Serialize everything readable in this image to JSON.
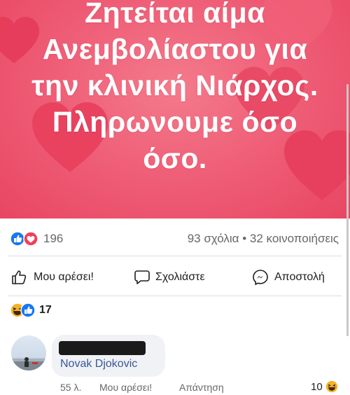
{
  "post": {
    "text_lines": [
      "Ζητείται αίμα",
      "Ανεμβολίαστου για",
      "την κλινική Νιάρχος.",
      "Πληρωνουμε όσο",
      "όσο."
    ],
    "background_color": "#ee5b74"
  },
  "reactions": {
    "count": "196",
    "icons": [
      "like-icon",
      "love-icon"
    ]
  },
  "stats": {
    "comments_shares": "93 σχόλια • 32 κοινοποιήσεις"
  },
  "actions": {
    "like": "Μου αρέσει!",
    "comment": "Σχολιάστε",
    "send": "Αποστολή"
  },
  "comment_reactions": {
    "count": "17",
    "icons": [
      "haha-icon",
      "like-icon"
    ]
  },
  "comment": {
    "mention": "Novak Djokovic",
    "time": "55 λ.",
    "like": "Μου αρέσει!",
    "reply": "Απάντηση",
    "reaction_count": "10",
    "reaction_icon": "haha-icon"
  },
  "colors": {
    "like_blue": "#1877f2",
    "love_red": "#f33e58",
    "haha_yellow": "#f7b125",
    "mention_blue": "#385898"
  }
}
